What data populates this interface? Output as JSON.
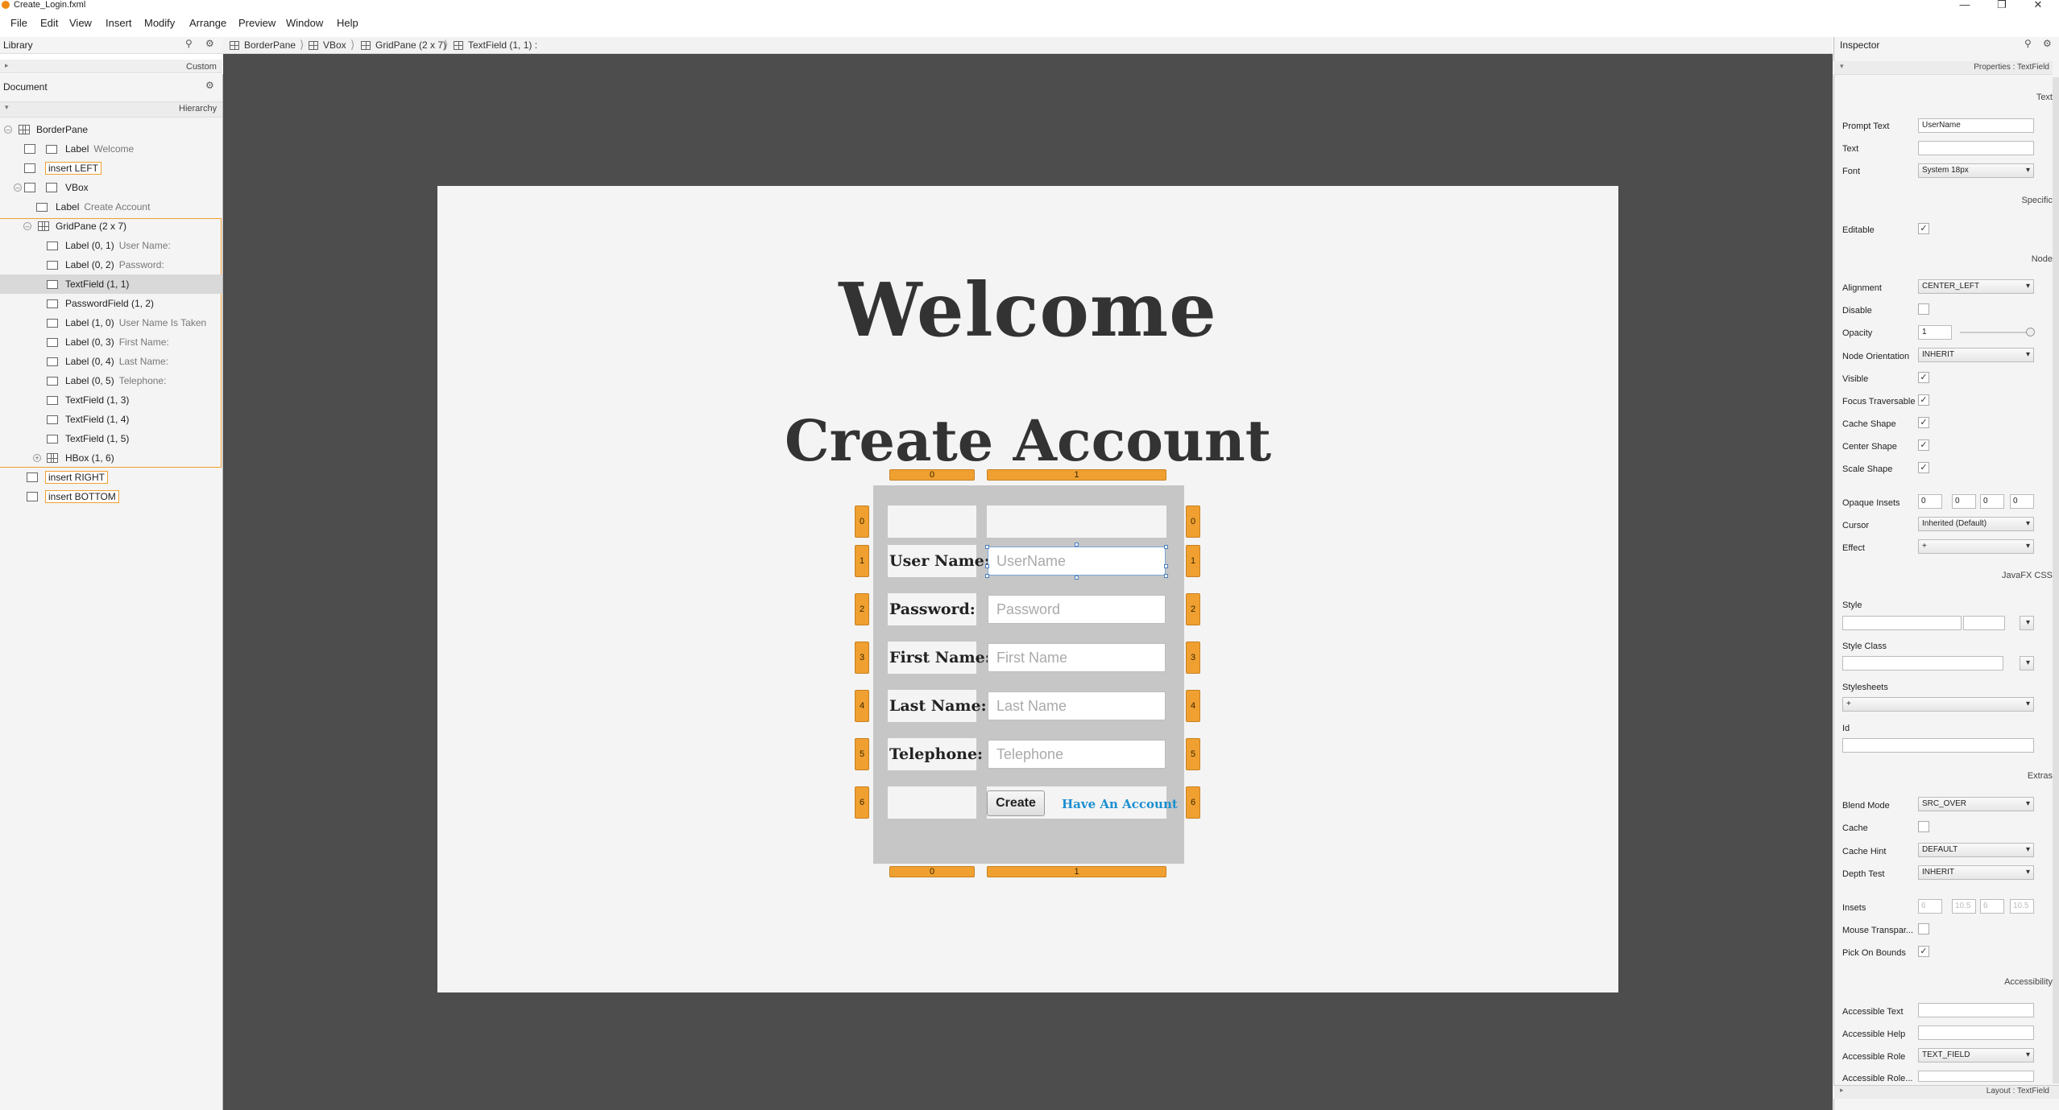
{
  "window": {
    "title": "Create_Login.fxml"
  },
  "menu": [
    "File",
    "Edit",
    "View",
    "Insert",
    "Modify",
    "Arrange",
    "Preview",
    "Window",
    "Help"
  ],
  "library": {
    "title": "Library",
    "custom": "Custom"
  },
  "document": {
    "title": "Document",
    "hierarchy": "Hierarchy"
  },
  "breadcrumb": [
    "BorderPane",
    "VBox",
    "GridPane (2 x 7)",
    "TextField (1, 1) :"
  ],
  "tree": [
    {
      "label": "BorderPane",
      "sub": ""
    },
    {
      "label": "Label",
      "sub": "Welcome"
    },
    {
      "label": "insert LEFT",
      "sub": ""
    },
    {
      "label": "VBox",
      "sub": ""
    },
    {
      "label": "Label",
      "sub": "Create Account"
    },
    {
      "label": "GridPane (2 x 7)",
      "sub": ""
    },
    {
      "label": "Label (0, 1)",
      "sub": "User Name:"
    },
    {
      "label": "Label (0, 2)",
      "sub": "Password:"
    },
    {
      "label": "TextField (1, 1)",
      "sub": ""
    },
    {
      "label": "PasswordField (1, 2)",
      "sub": ""
    },
    {
      "label": "Label (1, 0)",
      "sub": "User Name Is Taken"
    },
    {
      "label": "Label (0, 3)",
      "sub": "First Name:"
    },
    {
      "label": "Label (0, 4)",
      "sub": "Last Name:"
    },
    {
      "label": "Label (0, 5)",
      "sub": "Telephone:"
    },
    {
      "label": "TextField (1, 3)",
      "sub": ""
    },
    {
      "label": "TextField (1, 4)",
      "sub": ""
    },
    {
      "label": "TextField (1, 5)",
      "sub": ""
    },
    {
      "label": "HBox (1, 6)",
      "sub": ""
    },
    {
      "label": "insert RIGHT",
      "sub": ""
    },
    {
      "label": "insert BOTTOM",
      "sub": ""
    }
  ],
  "stage": {
    "welcome": "Welcome",
    "create_account": "Create Account",
    "col_tags": [
      "0",
      "1"
    ],
    "row_tags": [
      "0",
      "1",
      "2",
      "3",
      "4",
      "5",
      "6"
    ],
    "labels": [
      "User Name:",
      "Password:",
      "First Name:",
      "Last Name:",
      "Telephone:"
    ],
    "placeholders": [
      "UserName",
      "Password",
      "First Name",
      "Last Name",
      "Telephone"
    ],
    "create_button": "Create",
    "have_account": "Have An Account"
  },
  "inspector": {
    "title": "Inspector",
    "properties_header": "Properties : TextField",
    "sections": {
      "text": "Text",
      "specific": "Specific",
      "node": "Node",
      "css": "JavaFX CSS",
      "extras": "Extras",
      "accessibility": "Accessibility"
    },
    "labels": {
      "prompt_text": "Prompt Text",
      "text": "Text",
      "font": "Font",
      "editable": "Editable",
      "alignment": "Alignment",
      "disable": "Disable",
      "opacity": "Opacity",
      "node_orientation": "Node Orientation",
      "visible": "Visible",
      "focus_traversable": "Focus Traversable",
      "cache_shape": "Cache Shape",
      "center_shape": "Center Shape",
      "scale_shape": "Scale Shape",
      "opaque_insets": "Opaque Insets",
      "cursor": "Cursor",
      "effect": "Effect",
      "style": "Style",
      "style_class": "Style Class",
      "stylesheets": "Stylesheets",
      "id": "Id",
      "blend_mode": "Blend Mode",
      "cache": "Cache",
      "cache_hint": "Cache Hint",
      "depth_test": "Depth Test",
      "insets": "Insets",
      "mouse_transparent": "Mouse Transpar...",
      "pick_on_bounds": "Pick On Bounds",
      "accessible_text": "Accessible Text",
      "accessible_help": "Accessible Help",
      "accessible_role": "Accessible Role",
      "accessible_role_desc": "Accessible Role..."
    },
    "values": {
      "prompt_text": "UserName",
      "text": "",
      "font": "System 18px",
      "alignment": "CENTER_LEFT",
      "opacity": "1",
      "node_orientation": "INHERIT",
      "cursor": "Inherited (Default)",
      "effect": "+",
      "stylesheets": "+",
      "blend_mode": "SRC_OVER",
      "cache_hint": "DEFAULT",
      "depth_test": "INHERIT",
      "accessible_role": "TEXT_FIELD",
      "opaque_insets": [
        "0",
        "0",
        "0",
        "0"
      ],
      "insets": [
        "6",
        "10.5",
        "6",
        "10.5"
      ]
    },
    "layout_footer": "Layout : TextField"
  }
}
